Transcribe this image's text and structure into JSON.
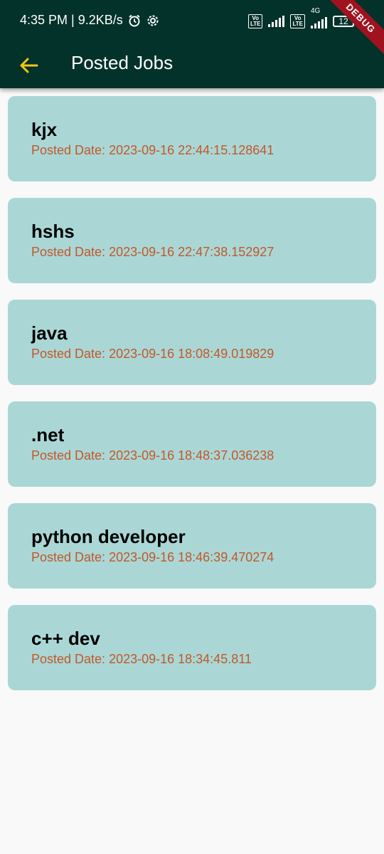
{
  "status_bar": {
    "time_speed": "4:35 PM | 9.2KB/s",
    "volte_label": "Vo\nLTE",
    "network_label": "4G",
    "battery": "12"
  },
  "debug_banner": "DEBUG",
  "appbar": {
    "title": "Posted Jobs",
    "back_icon": "arrow-back-icon",
    "accent": "#f5c518",
    "background": "#03322a"
  },
  "jobs": [
    {
      "title": "kjx",
      "date": "Posted Date: 2023-09-16 22:44:15.128641"
    },
    {
      "title": "hshs",
      "date": "Posted Date: 2023-09-16 22:47:38.152927"
    },
    {
      "title": "java",
      "date": "Posted Date: 2023-09-16 18:08:49.019829"
    },
    {
      "title": ".net",
      "date": "Posted Date: 2023-09-16 18:48:37.036238"
    },
    {
      "title": "python developer",
      "date": "Posted Date: 2023-09-16 18:46:39.470274"
    },
    {
      "title": "c++ dev",
      "date": "Posted Date: 2023-09-16 18:34:45.811"
    }
  ],
  "colors": {
    "card": "#aad7d6",
    "date_text": "#c2582a"
  }
}
